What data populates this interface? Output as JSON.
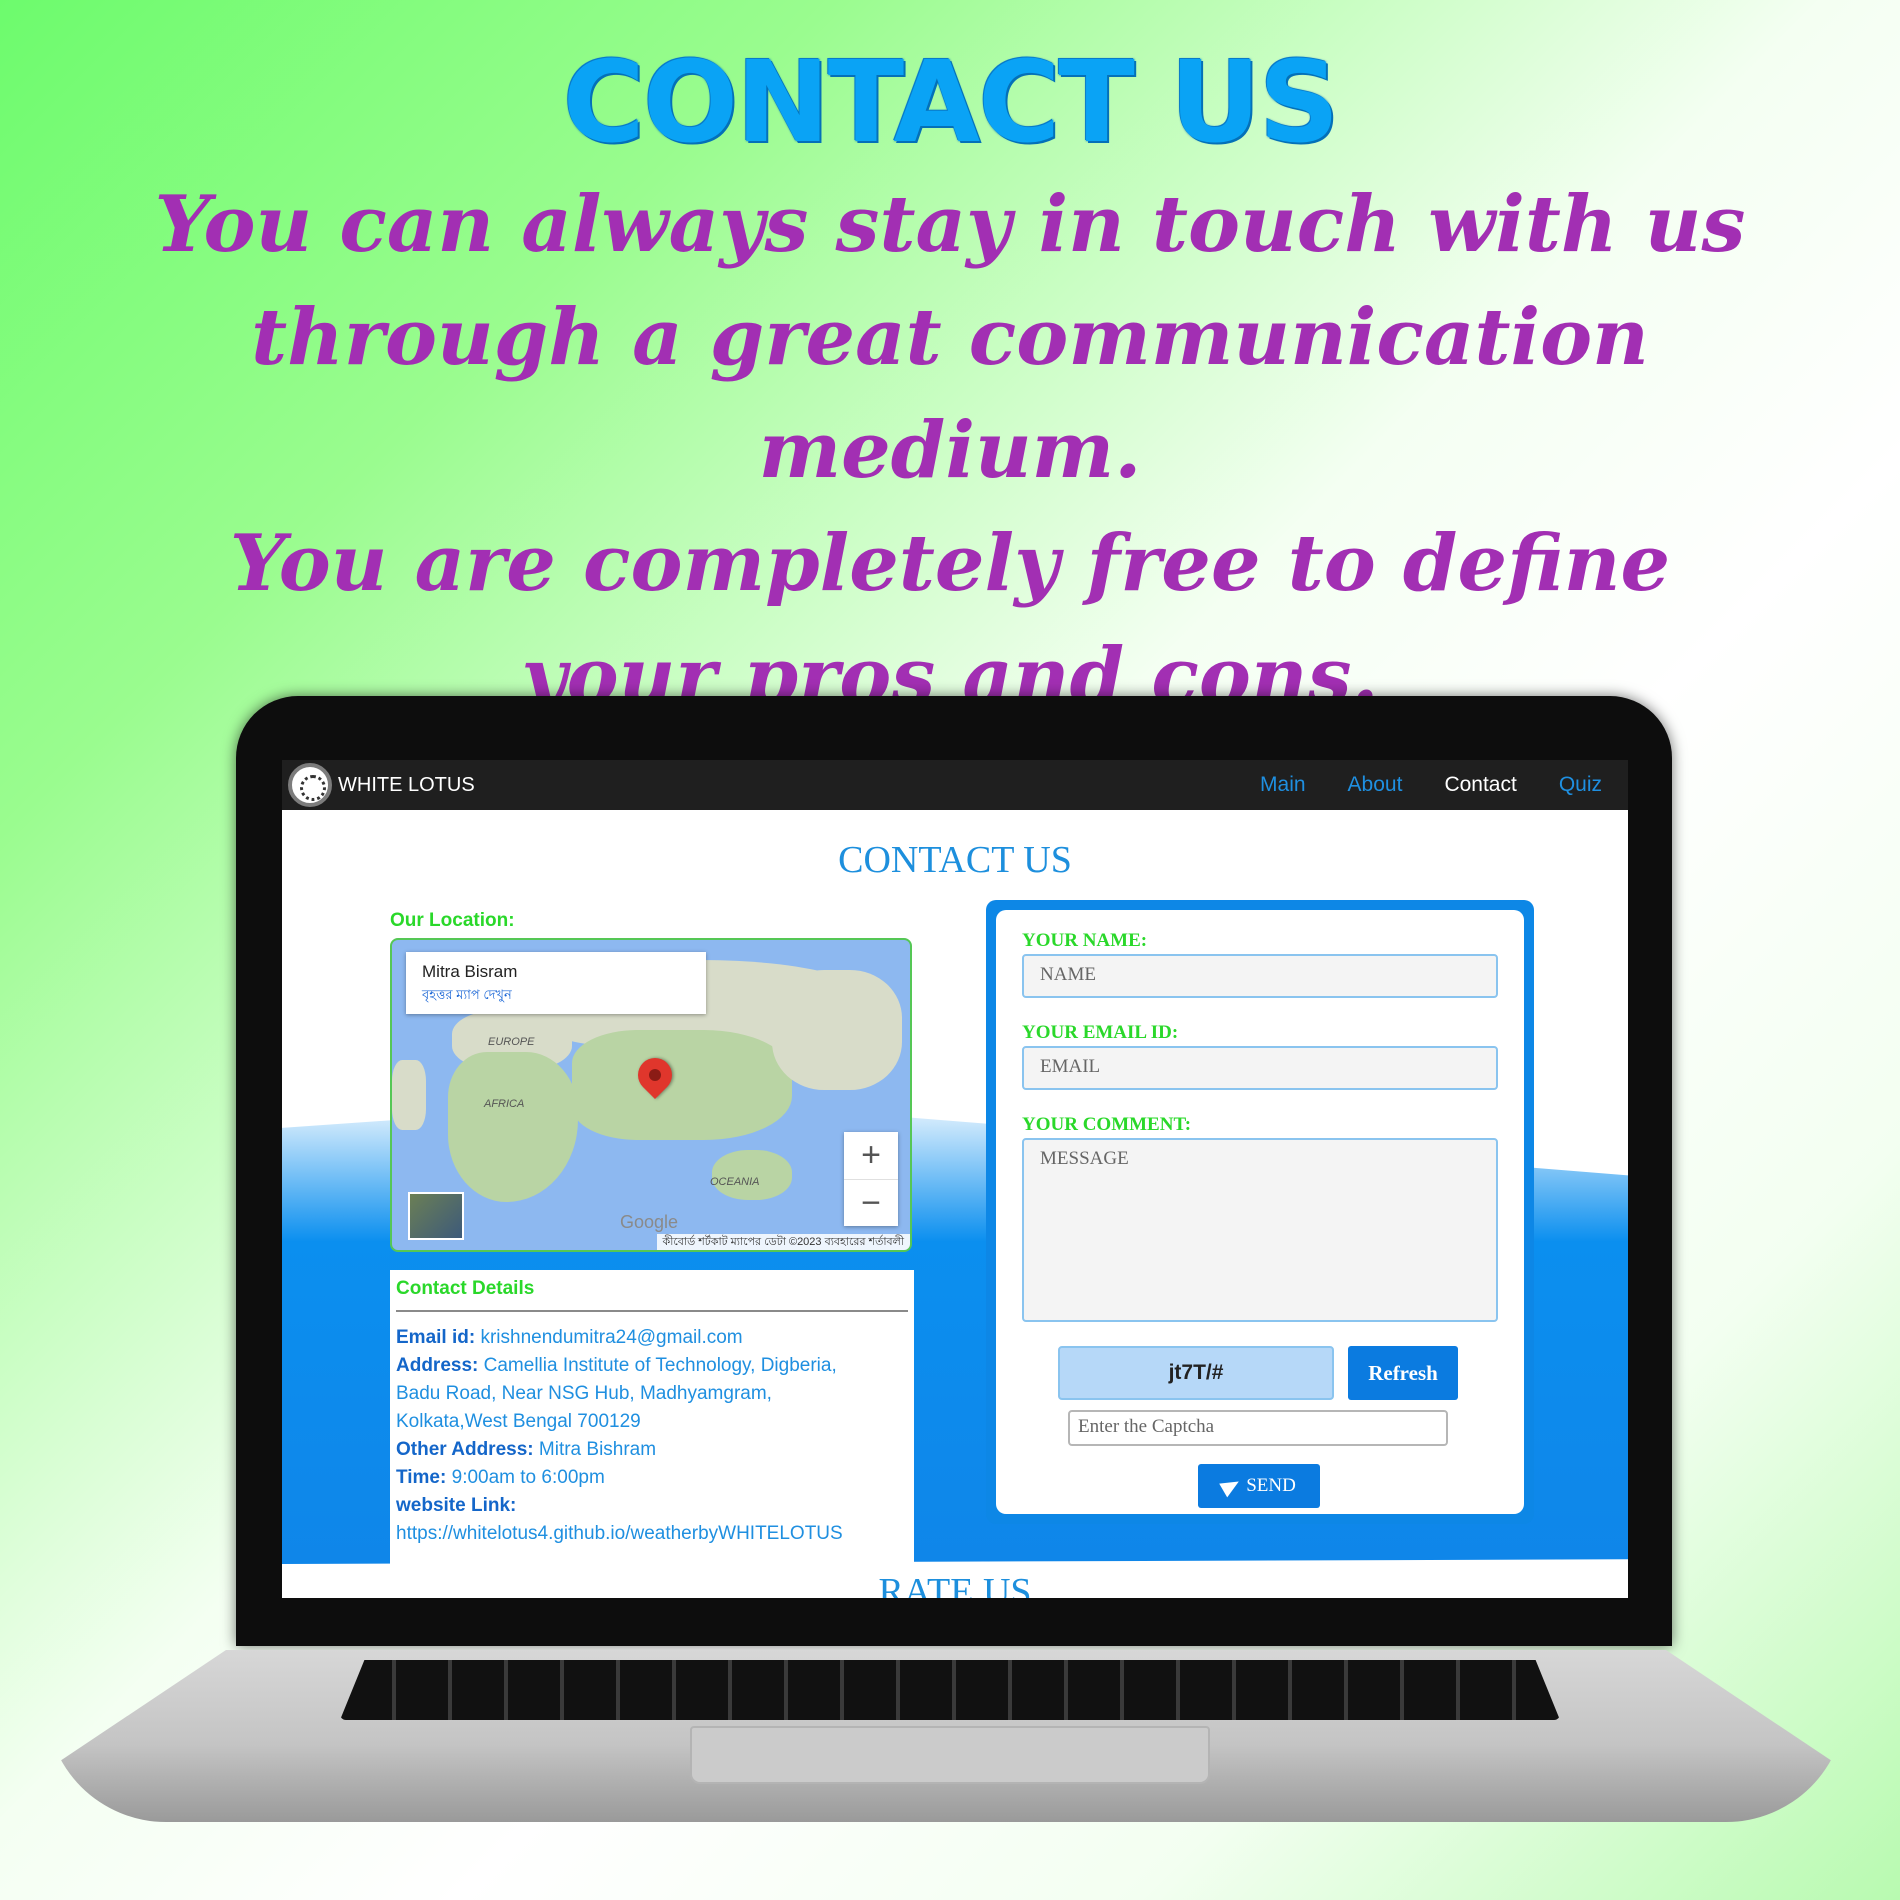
{
  "poster": {
    "title": "CONTACT US",
    "tagline": [
      "You can always stay in touch with us",
      "through a great communication medium.",
      "You are completely free to define",
      "your pros and cons."
    ]
  },
  "navbar": {
    "brand": "WHITE LOTUS",
    "links": [
      "Main",
      "About",
      "Contact",
      "Quiz"
    ],
    "active": "Contact"
  },
  "page": {
    "heading": "CONTACT US",
    "next_heading": "RATE US"
  },
  "location": {
    "label": "Our Location:",
    "place_name": "Mitra Bisram",
    "larger_map_link": "বৃহত্তর ম্যাপ দেখুন",
    "regions": [
      "EUROPE",
      "AFRICA",
      "OCEANIA"
    ],
    "google_logo": "Google",
    "footer": "কীবোর্ড শর্টকাট   ম্যাপের ডেটা ©2023   ব্যবহারের শর্তাবলী",
    "zoom_in": "+",
    "zoom_out": "−"
  },
  "contact_details": {
    "heading": "Contact Details",
    "email_label": "Email id:",
    "email": "krishnendumitra24@gmail.com",
    "address_label": "Address:",
    "address_line1": "Camellia Institute of Technology, Digberia,",
    "address_line2": "Badu Road, Near NSG Hub, Madhyamgram,",
    "address_line3": "Kolkata,West Bengal 700129",
    "other_address_label": "Other Address:",
    "other_address": "Mitra Bishram",
    "time_label": "Time:",
    "time": "9:00am to 6:00pm",
    "website_label": "website Link:",
    "website": "https://whitelotus4.github.io/weatherbyWHITELOTUS"
  },
  "form": {
    "name_label": "YOUR NAME:",
    "name_placeholder": "NAME",
    "email_label": "YOUR EMAIL ID:",
    "email_placeholder": "EMAIL",
    "comment_label": "YOUR COMMENT:",
    "comment_placeholder": "MESSAGE",
    "captcha_text": "jt7T/#",
    "refresh_label": "Refresh",
    "captcha_placeholder": "Enter the Captcha",
    "send_label": "SEND"
  },
  "colors": {
    "brand_blue": "#0b7be0",
    "label_green": "#2ad82a",
    "tagline_purple": "#a22fb3",
    "title_blue": "#0aa3f5"
  }
}
